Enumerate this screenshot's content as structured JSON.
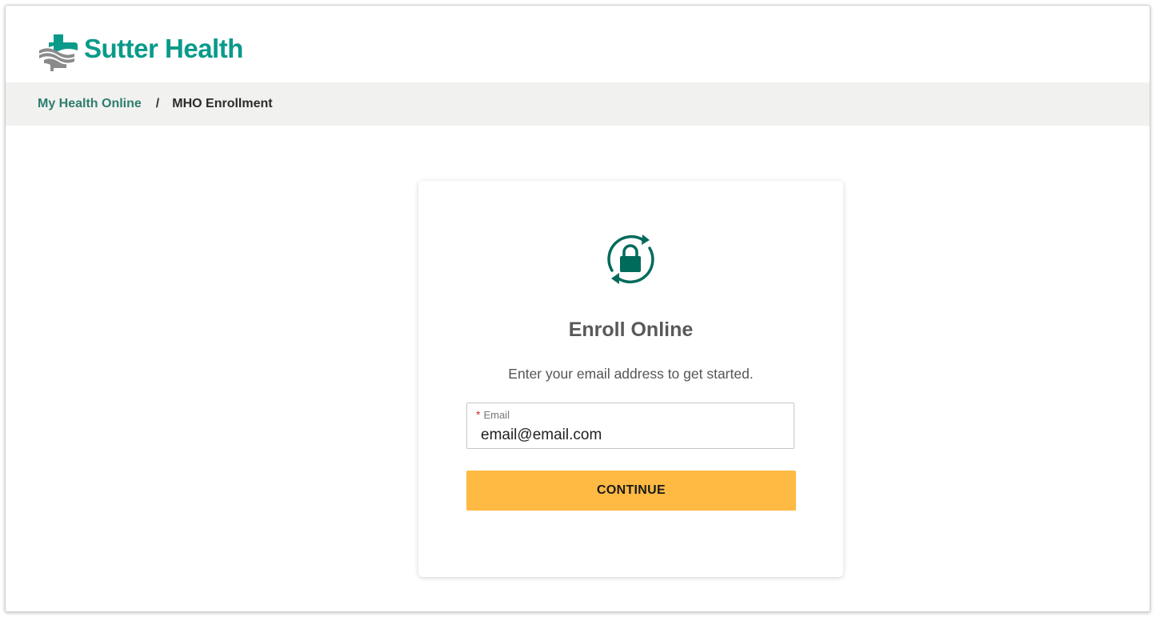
{
  "brand": {
    "name": "Sutter Health",
    "color": "#0a9a8a"
  },
  "breadcrumb": {
    "home": "My Health Online",
    "separator": "/",
    "current": "MHO Enrollment"
  },
  "enroll": {
    "icon": "lock-refresh-icon",
    "title": "Enroll Online",
    "subtitle": "Enter your email address to get started.",
    "email_label": "Email",
    "required_marker": "*",
    "email_value": "email@email.com",
    "continue_label": "CONTINUE"
  },
  "colors": {
    "accent": "#006b5b",
    "button": "#ffba43",
    "breadcrumb_bg": "#f1f1f0",
    "required": "#d32f2f"
  }
}
